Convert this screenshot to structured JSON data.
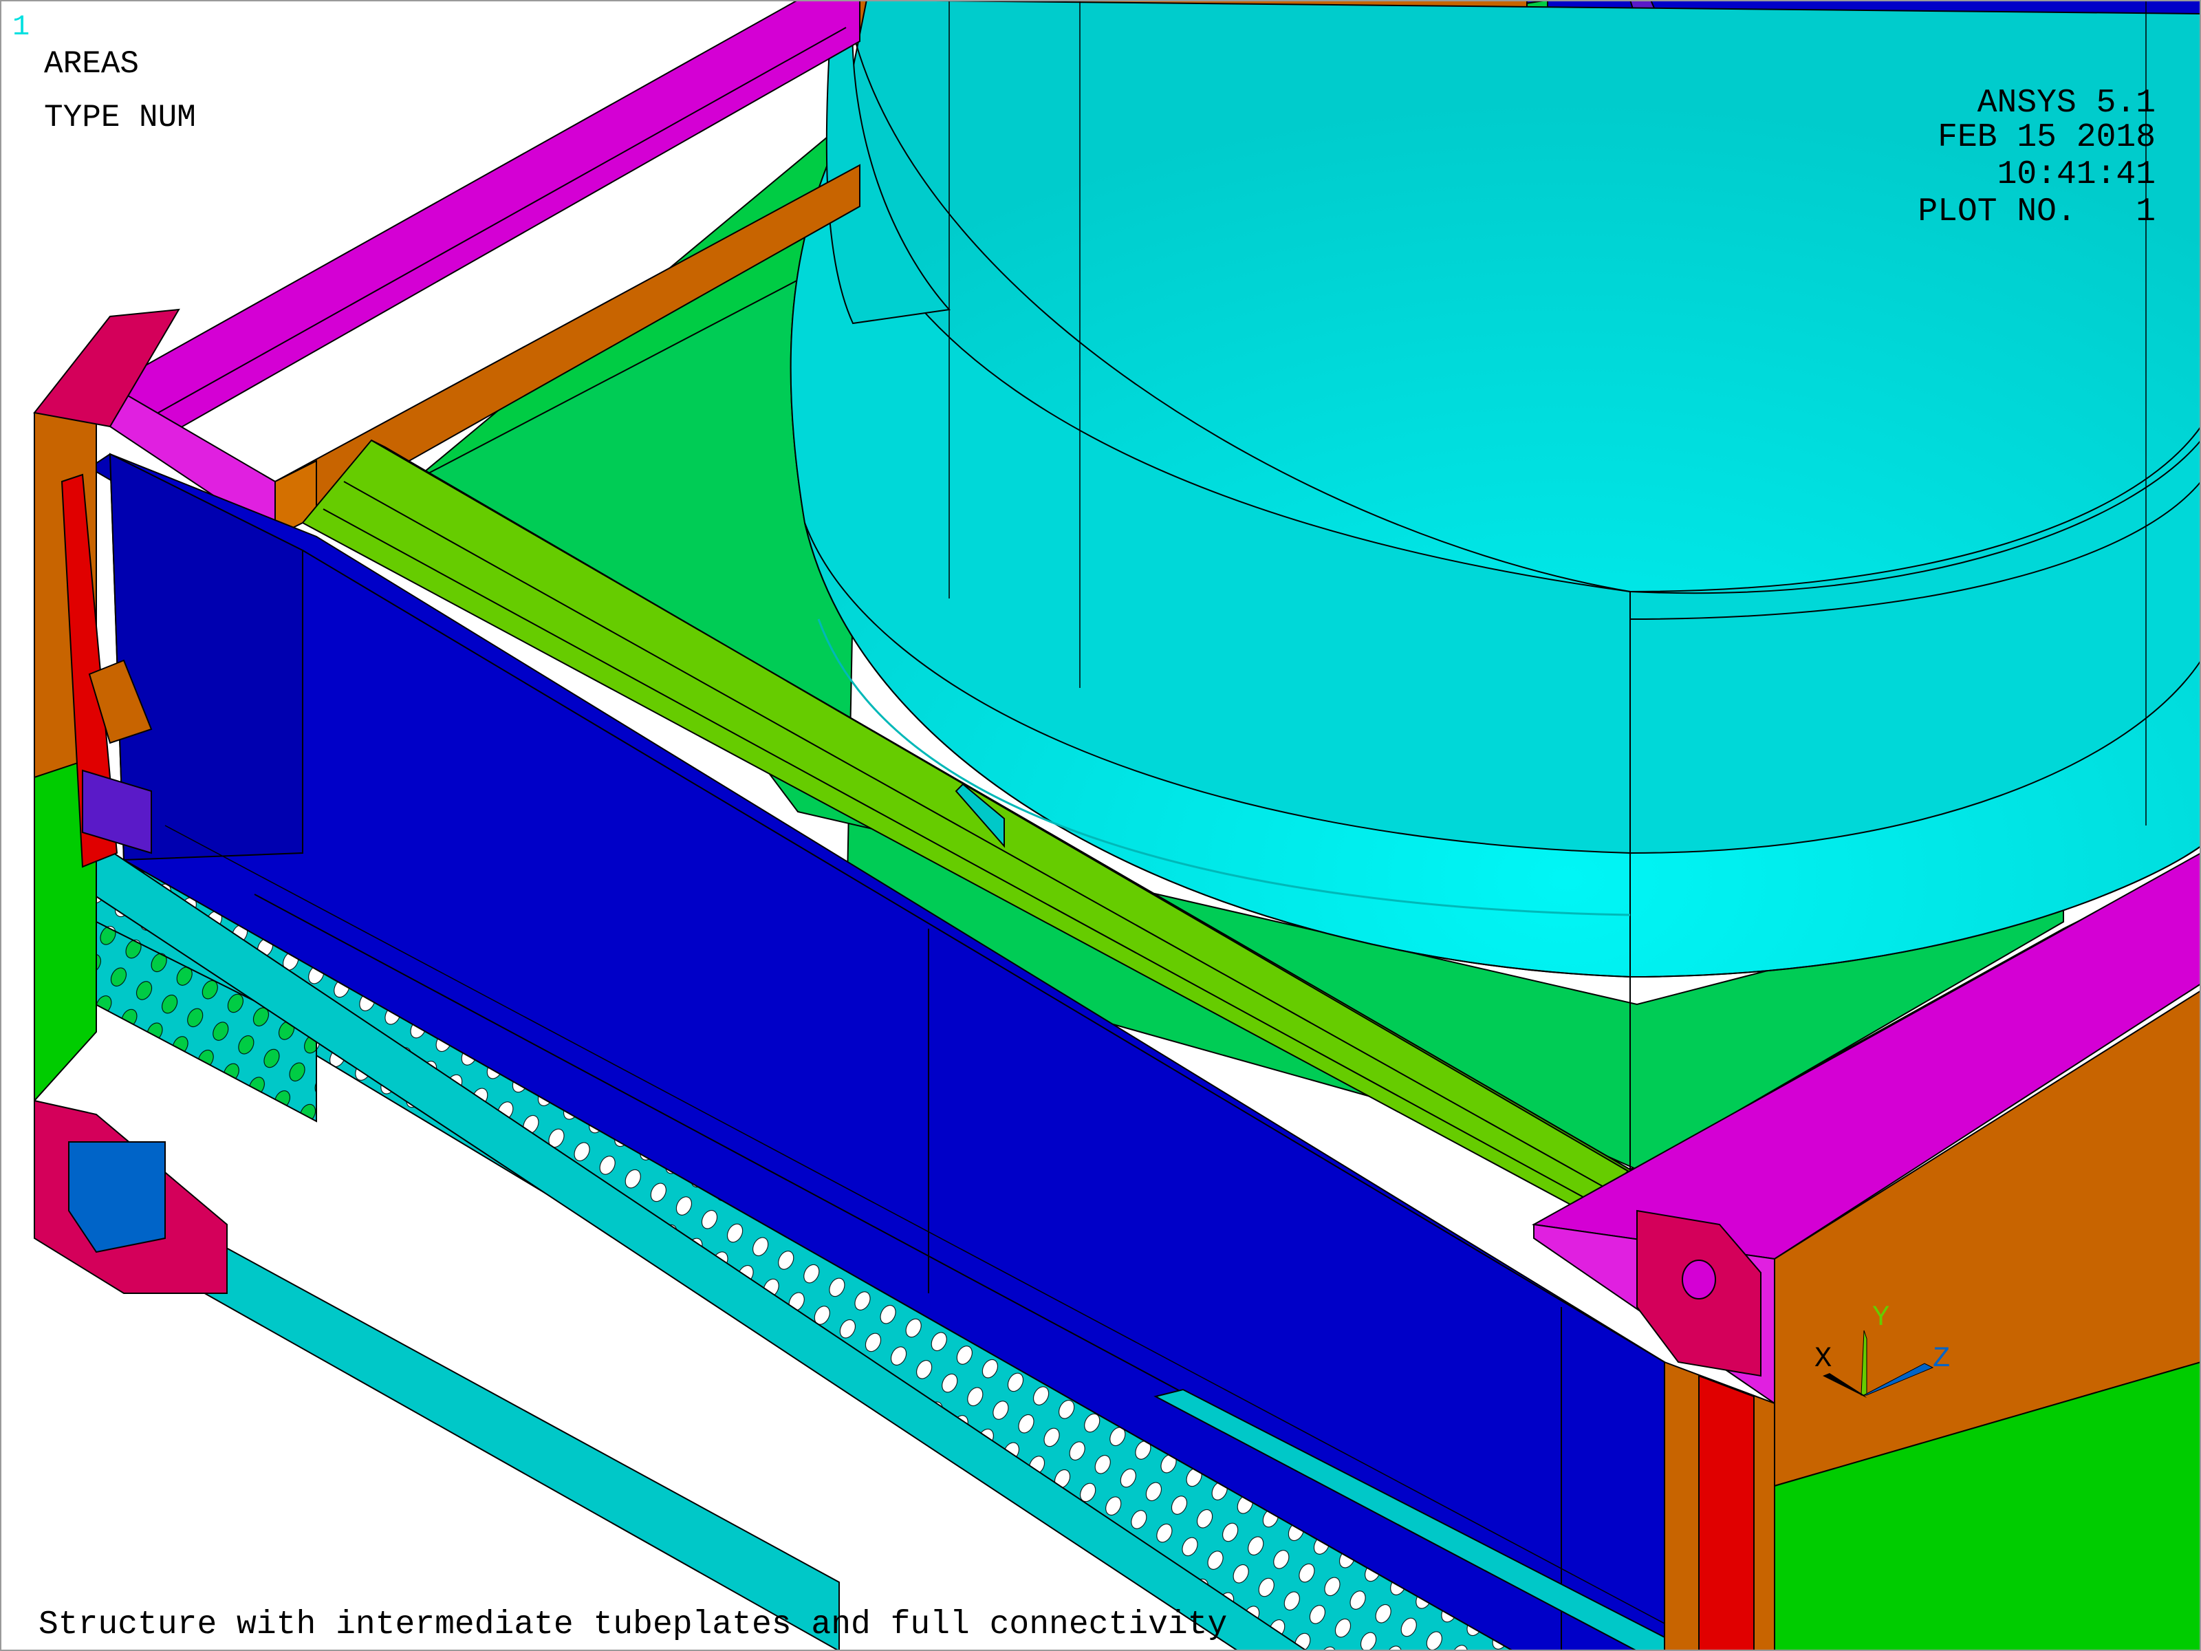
{
  "window": {
    "number": "1"
  },
  "labels": {
    "areas": "AREAS",
    "type_num": "TYPE NUM"
  },
  "info": {
    "program": "ANSYS 5.1",
    "date": "FEB 15 2018",
    "time": "10:41:41",
    "plot": "PLOT NO.   1"
  },
  "caption": "Structure with intermediate tubeplates and full connectivity",
  "triad": {
    "x": "X",
    "y": "Y",
    "z": "Z"
  },
  "colors": {
    "background": "#ffffff",
    "cyan_cylinder": "#00e0e0",
    "cyan_plate": "#00c8c8",
    "blue": "#0000c8",
    "green": "#00cc44",
    "lime": "#66cc00",
    "magenta": "#d400d4",
    "orange": "#c86400",
    "crimson": "#d4005a",
    "red": "#e00000",
    "purple": "#5a1ac8",
    "mid_blue": "#0064c8"
  }
}
